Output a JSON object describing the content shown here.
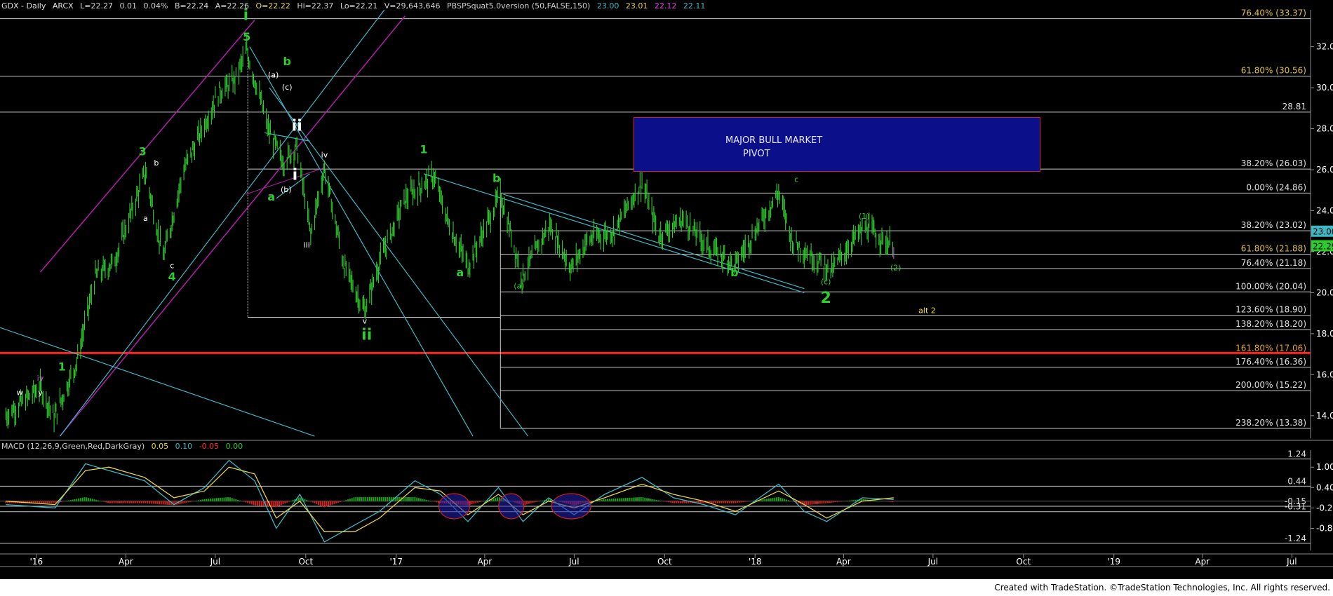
{
  "header": {
    "symbol": "GDX - Daily",
    "exchange": "ARCX",
    "last": "L=22.27",
    "change": "0.01",
    "change_pct": "0.04%",
    "bid": "B=22.24",
    "ask": "A=22.26",
    "open": "O=22.22",
    "high": "Hi=22.37",
    "low": "Lo=22.21",
    "volume": "V=29,643,646",
    "indicator": "PBSPSquat5.0version (50,FALSE,150)",
    "ind_values": [
      "23.00",
      "23.01",
      "22.12",
      "22.11"
    ]
  },
  "macd_header": {
    "label": "MACD (12,26,9,Green,Red,DarkGray)",
    "values": [
      "0.05",
      "0.10",
      "-0.05",
      "0.00"
    ]
  },
  "pivot_box": {
    "line1": "MAJOR BULL MARKET",
    "line2": "PIVOT"
  },
  "footer": "Created with TradeStation. ©TradeStation Technologies, Inc. All rights reserved.",
  "colors": {
    "background": "#000000",
    "price": "#2ecc2e",
    "fib_line": "#c8c8c8",
    "trend_line": "#3fb7c4",
    "channel": "#b01fa8",
    "support": "#ff2020",
    "macd_line": "#3fb7c4",
    "signal_line": "#e8d24a",
    "hist_pos": "#18a018",
    "hist_neg": "#d02020",
    "pivot_box": "#0b0f8a"
  },
  "chart_data": [
    {
      "type": "line",
      "title": "",
      "xlabel": "",
      "ylabel": "",
      "x_ticks": [
        "'16",
        "Apr",
        "Jul",
        "Oct",
        "'17",
        "Apr",
        "Jul",
        "Oct",
        "'18",
        "Apr",
        "Jul",
        "Oct",
        "'19",
        "Apr",
        "Jul"
      ],
      "y_ticks": [
        "32.00",
        "30.00",
        "28.00",
        "26.00",
        "24.00",
        "22.00",
        "20.00",
        "18.00",
        "16.00",
        "14.00"
      ],
      "ylim": [
        12.9,
        33.8
      ],
      "series": [
        {
          "x": [
            "2015-12-01",
            "2016-01-05",
            "2016-01-19",
            "2016-02-11",
            "2016-03-01",
            "2016-03-20",
            "2016-04-21",
            "2016-05-09",
            "2016-05-30",
            "2016-07-05",
            "2016-07-20",
            "2016-08-02",
            "2016-08-25",
            "2016-09-08",
            "2016-09-22",
            "2016-10-06",
            "2016-10-20",
            "2016-11-09",
            "2016-11-30",
            "2016-12-15",
            "2017-01-10",
            "2017-02-08",
            "2017-02-23",
            "2017-03-15",
            "2017-04-17",
            "2017-05-09",
            "2017-06-06",
            "2017-06-28",
            "2017-07-15",
            "2017-08-10",
            "2017-09-08",
            "2017-09-25",
            "2017-10-20",
            "2017-11-15",
            "2017-12-12",
            "2018-01-25",
            "2018-02-08",
            "2018-03-05",
            "2018-03-20",
            "2018-04-11",
            "2018-04-24",
            "2018-05-10",
            "2018-05-22"
          ],
          "values": [
            14.0,
            15.4,
            13.9,
            16.6,
            20.8,
            21.5,
            25.9,
            21.7,
            26.0,
            29.8,
            30.3,
            31.8,
            27.8,
            26.4,
            27.1,
            22.8,
            26.1,
            21.3,
            19.1,
            21.5,
            24.6,
            25.7,
            23.4,
            21.3,
            24.8,
            20.8,
            23.3,
            21.2,
            22.6,
            23.0,
            25.4,
            22.8,
            23.6,
            22.2,
            21.4,
            24.9,
            22.5,
            21.6,
            21.1,
            22.6,
            23.2,
            22.6,
            22.3
          ]
        }
      ],
      "horizontal_levels": [
        {
          "label": "76.40% (33.37)",
          "value": 33.37
        },
        {
          "label": "61.80% (30.56)",
          "value": 30.56
        },
        {
          "label": "28.81",
          "value": 28.81
        },
        {
          "label": "38.20% (26.03)",
          "value": 26.03
        },
        {
          "label": "0.00% (24.86)",
          "value": 24.86
        },
        {
          "label": "38.20% (23.02)",
          "value": 23.02
        },
        {
          "label": "61.80% (21.88)",
          "value": 21.88
        },
        {
          "label": "76.40% (21.18)",
          "value": 21.18
        },
        {
          "label": "100.00% (20.04)",
          "value": 20.04
        },
        {
          "label": "123.60% (18.90)",
          "value": 18.9
        },
        {
          "label": "138.20% (18.20)",
          "value": 18.2
        },
        {
          "label": "161.80% (17.06)",
          "value": 17.06
        },
        {
          "label": "176.40% (16.36)",
          "value": 16.36
        },
        {
          "label": "200.00% (15.22)",
          "value": 15.22
        },
        {
          "label": "238.20% (13.38)",
          "value": 13.38
        }
      ],
      "price_badges": [
        {
          "text": "23.00",
          "value": 23.0
        },
        {
          "text": "22.29",
          "value": 22.29
        }
      ],
      "wave_labels": [
        {
          "text": "w",
          "date": "2015-12-15",
          "value": 15.0,
          "color": "#ffffff"
        },
        {
          "text": "y",
          "date": "2016-01-05",
          "value": 15.0,
          "color": "#ffffff"
        },
        {
          "text": "iv",
          "date": "2016-01-05",
          "value": 15.7,
          "color": "#e040e0"
        },
        {
          "text": "1",
          "date": "2016-01-27",
          "value": 16.2,
          "color": "#2ecc2e"
        },
        {
          "text": "3",
          "date": "2016-04-18",
          "value": 26.7,
          "color": "#2ecc2e"
        },
        {
          "text": "b",
          "date": "2016-05-02",
          "value": 26.2,
          "color": "#ffffff"
        },
        {
          "text": "a",
          "date": "2016-04-21",
          "value": 23.5,
          "color": "#ffffff"
        },
        {
          "text": "c",
          "date": "2016-05-18",
          "value": 21.2,
          "color": "#ffffff"
        },
        {
          "text": "4",
          "date": "2016-05-18",
          "value": 20.6,
          "color": "#2ecc2e"
        },
        {
          "text": "i",
          "date": "2016-08-01",
          "value": 33.3,
          "color": "#2ecc2e"
        },
        {
          "text": "5",
          "date": "2016-08-02",
          "value": 32.3,
          "color": "#2ecc2e"
        },
        {
          "text": "b",
          "date": "2016-09-12",
          "value": 31.1,
          "color": "#2ecc2e"
        },
        {
          "text": "(a)",
          "date": "2016-08-29",
          "value": 30.5,
          "color": "#ffffff"
        },
        {
          "text": "(c)",
          "date": "2016-09-12",
          "value": 29.9,
          "color": "#ffffff"
        },
        {
          "text": "ii",
          "date": "2016-09-22",
          "value": 27.9,
          "color": "#ffffff"
        },
        {
          "text": "i",
          "date": "2016-09-20",
          "value": 25.5,
          "color": "#ffffff"
        },
        {
          "text": "(b)",
          "date": "2016-09-11",
          "value": 24.9,
          "color": "#ffffff"
        },
        {
          "text": "a",
          "date": "2016-08-27",
          "value": 24.5,
          "color": "#2ecc2e"
        },
        {
          "text": "iv",
          "date": "2016-10-20",
          "value": 26.6,
          "color": "#ffffff"
        },
        {
          "text": "iii",
          "date": "2016-10-02",
          "value": 22.2,
          "color": "#ffffff"
        },
        {
          "text": "v",
          "date": "2016-11-30",
          "value": 18.5,
          "color": "#ffffff"
        },
        {
          "text": "ii",
          "date": "2016-12-02",
          "value": 17.7,
          "color": "#2ecc2e"
        },
        {
          "text": "1",
          "date": "2017-01-29",
          "value": 26.8,
          "color": "#2ecc2e"
        },
        {
          "text": "b",
          "date": "2017-04-13",
          "value": 25.4,
          "color": "#2ecc2e"
        },
        {
          "text": "a",
          "date": "2017-03-07",
          "value": 20.8,
          "color": "#2ecc2e"
        },
        {
          "text": "(a)",
          "date": "2017-05-06",
          "value": 20.2,
          "color": "#2ecc2e"
        },
        {
          "text": "a",
          "date": "2017-09-08",
          "value": 25.9,
          "color": "#2ecc2e"
        },
        {
          "text": "b",
          "date": "2017-12-11",
          "value": 20.8,
          "color": "#2ecc2e"
        },
        {
          "text": "(b)",
          "date": "2018-02-15",
          "value": 26.0,
          "color": "#2ecc2e"
        },
        {
          "text": "c",
          "date": "2018-02-12",
          "value": 25.4,
          "color": "#2ecc2e"
        },
        {
          "text": "(c)",
          "date": "2018-03-14",
          "value": 20.4,
          "color": "#2ecc2e"
        },
        {
          "text": "2",
          "date": "2018-03-14",
          "value": 19.5,
          "color": "#2ecc2e"
        },
        {
          "text": "(1)",
          "date": "2018-04-22",
          "value": 23.6,
          "color": "#2ecc2e"
        },
        {
          "text": "(2)",
          "date": "2018-05-24",
          "value": 21.1,
          "color": "#2ecc2e"
        },
        {
          "text": "alt 2",
          "date": "2018-06-25",
          "value": 19.0,
          "color": "#f0e020"
        }
      ]
    },
    {
      "type": "line",
      "title": "",
      "xlabel": "",
      "ylabel": "",
      "y_ticks": [
        "1.00",
        "0.40",
        "-0.20",
        "-0.80"
      ],
      "ylim": [
        -1.45,
        1.5
      ],
      "levels": [
        {
          "label": "1.24",
          "value": 1.24
        },
        {
          "label": "0.44",
          "value": 0.44
        },
        {
          "label": "-0.15",
          "value": -0.15
        },
        {
          "label": "-0.31",
          "value": -0.31
        },
        {
          "label": "-1.24",
          "value": -1.24
        }
      ],
      "series": [
        {
          "x": [
            "2015-12-01",
            "2016-01-20",
            "2016-02-20",
            "2016-03-15",
            "2016-04-20",
            "2016-05-20",
            "2016-06-20",
            "2016-07-15",
            "2016-08-10",
            "2016-09-01",
            "2016-09-25",
            "2016-10-20",
            "2016-11-20",
            "2016-12-15",
            "2017-01-20",
            "2017-02-15",
            "2017-03-15",
            "2017-04-15",
            "2017-05-10",
            "2017-06-05",
            "2017-07-01",
            "2017-08-01",
            "2017-09-08",
            "2017-10-10",
            "2017-11-10",
            "2017-12-12",
            "2018-01-25",
            "2018-02-20",
            "2018-03-15",
            "2018-04-20",
            "2018-05-22"
          ],
          "values": [
            -0.1,
            -0.2,
            1.1,
            0.9,
            0.6,
            -0.1,
            0.4,
            1.2,
            0.6,
            -0.8,
            0.2,
            -1.2,
            -0.7,
            -0.3,
            0.6,
            0.2,
            -0.6,
            0.4,
            -0.6,
            0.1,
            -0.4,
            0.2,
            0.7,
            0.1,
            -0.1,
            -0.4,
            0.5,
            -0.3,
            -0.6,
            0.1,
            0.05
          ]
        },
        {
          "x": [
            "2015-12-01",
            "2016-01-20",
            "2016-02-20",
            "2016-03-15",
            "2016-04-20",
            "2016-05-20",
            "2016-06-20",
            "2016-07-15",
            "2016-08-10",
            "2016-09-01",
            "2016-09-25",
            "2016-10-20",
            "2016-11-20",
            "2016-12-15",
            "2017-01-20",
            "2017-02-15",
            "2017-03-15",
            "2017-04-15",
            "2017-05-10",
            "2017-06-05",
            "2017-07-01",
            "2017-08-01",
            "2017-09-08",
            "2017-10-10",
            "2017-11-10",
            "2017-12-12",
            "2018-01-25",
            "2018-02-20",
            "2018-03-15",
            "2018-04-20",
            "2018-05-22"
          ],
          "values": [
            0.0,
            -0.1,
            0.9,
            1.0,
            0.7,
            0.1,
            0.3,
            1.0,
            0.8,
            -0.5,
            0.0,
            -0.9,
            -0.9,
            -0.5,
            0.4,
            0.3,
            -0.4,
            0.2,
            -0.4,
            0.0,
            -0.2,
            0.1,
            0.5,
            0.2,
            0.0,
            -0.3,
            0.3,
            -0.1,
            -0.5,
            0.0,
            0.1
          ]
        }
      ]
    }
  ]
}
